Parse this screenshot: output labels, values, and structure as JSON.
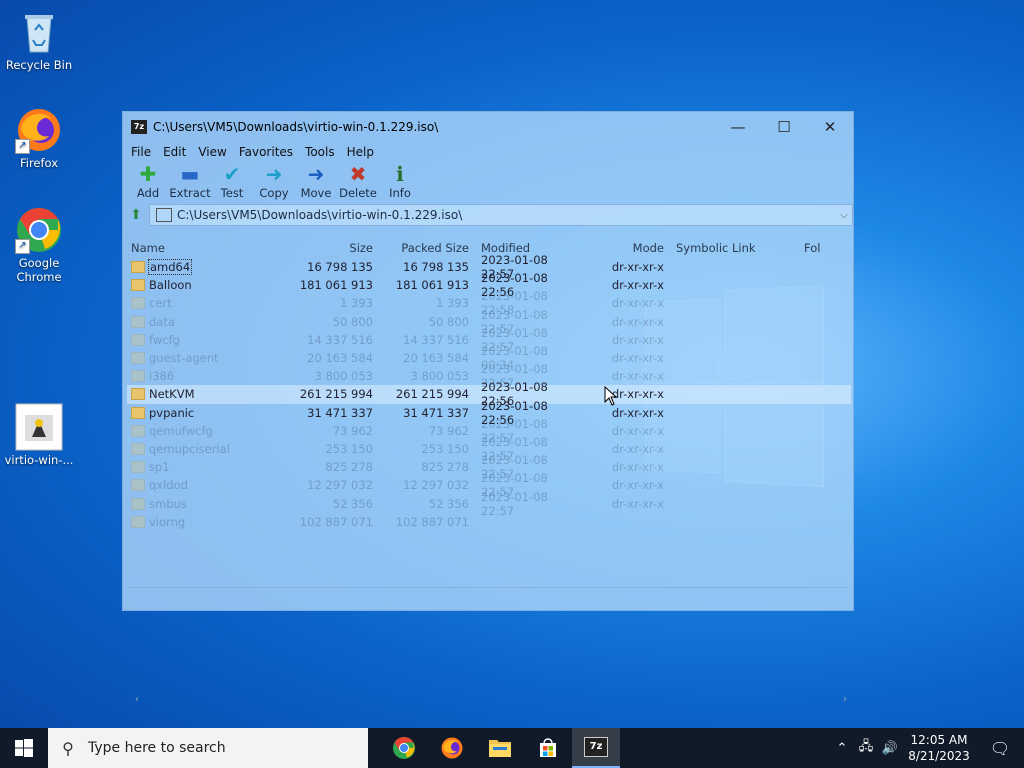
{
  "desktop": {
    "icons": [
      {
        "label": "Recycle Bin"
      },
      {
        "label": "Firefox"
      },
      {
        "label": "Google Chrome"
      },
      {
        "label": "virtio-win-..."
      }
    ]
  },
  "window": {
    "title": "C:\\Users\\VM5\\Downloads\\virtio-win-0.1.229.iso\\",
    "app_icon_text": "7z",
    "controls": {
      "minimize": "—",
      "maximize": "☐",
      "close": "✕"
    },
    "menu": [
      "File",
      "Edit",
      "View",
      "Favorites",
      "Tools",
      "Help"
    ],
    "toolbar": [
      {
        "label": "Add",
        "glyph": "✚",
        "color": "#2eaa3c"
      },
      {
        "label": "Extract",
        "glyph": "▬",
        "color": "#2867c7"
      },
      {
        "label": "Test",
        "glyph": "✔",
        "color": "#1aa0c8"
      },
      {
        "label": "Copy",
        "glyph": "➜",
        "color": "#1aa0c8"
      },
      {
        "label": "Move",
        "glyph": "➜",
        "color": "#1f5fbf"
      },
      {
        "label": "Delete",
        "glyph": "✖",
        "color": "#c0392b"
      },
      {
        "label": "Info",
        "glyph": "ℹ",
        "color": "#2d6b2d"
      }
    ],
    "address": "C:\\Users\\VM5\\Downloads\\virtio-win-0.1.229.iso\\",
    "columns": {
      "name": "Name",
      "size": "Size",
      "packed": "Packed Size",
      "modified": "Modified",
      "mode": "Mode",
      "symlink": "Symbolic Link",
      "folder": "Fol"
    },
    "rows": [
      {
        "name": "amd64",
        "size": "16 798 135",
        "packed": "16 798 135",
        "modified": "2023-01-08 22:57",
        "mode": "dr-xr-xr-x",
        "state": "focus"
      },
      {
        "name": "Balloon",
        "size": "181 061 913",
        "packed": "181 061 913",
        "modified": "2023-01-08 22:56",
        "mode": "dr-xr-xr-x",
        "state": "normal"
      },
      {
        "name": "cert",
        "size": "1 393",
        "packed": "1 393",
        "modified": "2023-01-08 22:58",
        "mode": "dr-xr-xr-x",
        "state": "faded"
      },
      {
        "name": "data",
        "size": "50 800",
        "packed": "50 800",
        "modified": "2023-01-08 22:57",
        "mode": "dr-xr-xr-x",
        "state": "faded"
      },
      {
        "name": "fwcfg",
        "size": "14 337 516",
        "packed": "14 337 516",
        "modified": "2023-01-08 22:57",
        "mode": "dr-xr-xr-x",
        "state": "faded"
      },
      {
        "name": "guest-agent",
        "size": "20 163 584",
        "packed": "20 163 584",
        "modified": "2023-01-08 00:34",
        "mode": "dr-xr-xr-x",
        "state": "faded"
      },
      {
        "name": "i386",
        "size": "3 800 053",
        "packed": "3 800 053",
        "modified": "2023-01-08 22:57",
        "mode": "dr-xr-xr-x",
        "state": "faded"
      },
      {
        "name": "NetKVM",
        "size": "261 215 994",
        "packed": "261 215 994",
        "modified": "2023-01-08 22:56",
        "mode": "dr-xr-xr-x",
        "state": "selected"
      },
      {
        "name": "pvpanic",
        "size": "31 471 337",
        "packed": "31 471 337",
        "modified": "2023-01-08 22:56",
        "mode": "dr-xr-xr-x",
        "state": "normal"
      },
      {
        "name": "qemufwcfg",
        "size": "73 962",
        "packed": "73 962",
        "modified": "2023-01-08 22:57",
        "mode": "dr-xr-xr-x",
        "state": "faded"
      },
      {
        "name": "qemupciserial",
        "size": "253 150",
        "packed": "253 150",
        "modified": "2023-01-08 22:57",
        "mode": "dr-xr-xr-x",
        "state": "faded"
      },
      {
        "name": "sp1",
        "size": "825 278",
        "packed": "825 278",
        "modified": "2023-01-08 22:57",
        "mode": "dr-xr-xr-x",
        "state": "faded"
      },
      {
        "name": "qxldod",
        "size": "12 297 032",
        "packed": "12 297 032",
        "modified": "2023-01-08 22:57",
        "mode": "dr-xr-xr-x",
        "state": "faded"
      },
      {
        "name": "smbus",
        "size": "52 356",
        "packed": "52 356",
        "modified": "2023-01-08 22:57",
        "mode": "dr-xr-xr-x",
        "state": "faded"
      },
      {
        "name": "viorng",
        "size": "102 887 071",
        "packed": "102 887 071",
        "modified": "",
        "mode": "",
        "state": "faded"
      }
    ]
  },
  "taskbar": {
    "search_placeholder": "Type here to search",
    "time": "12:05 AM",
    "date": "8/21/2023",
    "active_app_text": "7z"
  }
}
